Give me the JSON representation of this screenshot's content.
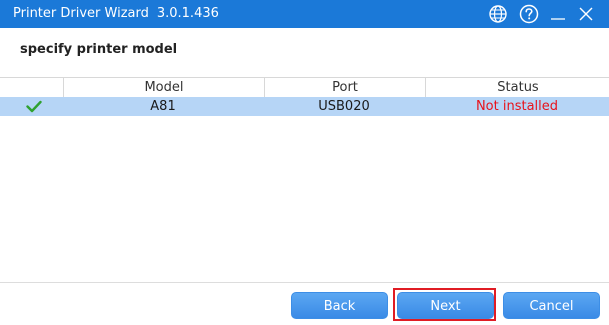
{
  "window": {
    "title": "Printer Driver Wizard",
    "version": "3.0.1.436",
    "icons": {
      "globe": "globe-icon",
      "help": "help-icon",
      "minimize": "minimize-icon",
      "close": "close-icon"
    },
    "accent_color": "#1b79d8"
  },
  "main": {
    "heading": "specify printer model"
  },
  "table": {
    "columns": [
      "",
      "Model",
      "Port",
      "Status"
    ],
    "rows": [
      {
        "checked": true,
        "model": "A81",
        "port": "USB020",
        "status": "Not installed",
        "status_color": "#e8131b",
        "selected": true
      }
    ]
  },
  "buttons": {
    "back": "Back",
    "next": "Next",
    "cancel": "Cancel"
  }
}
